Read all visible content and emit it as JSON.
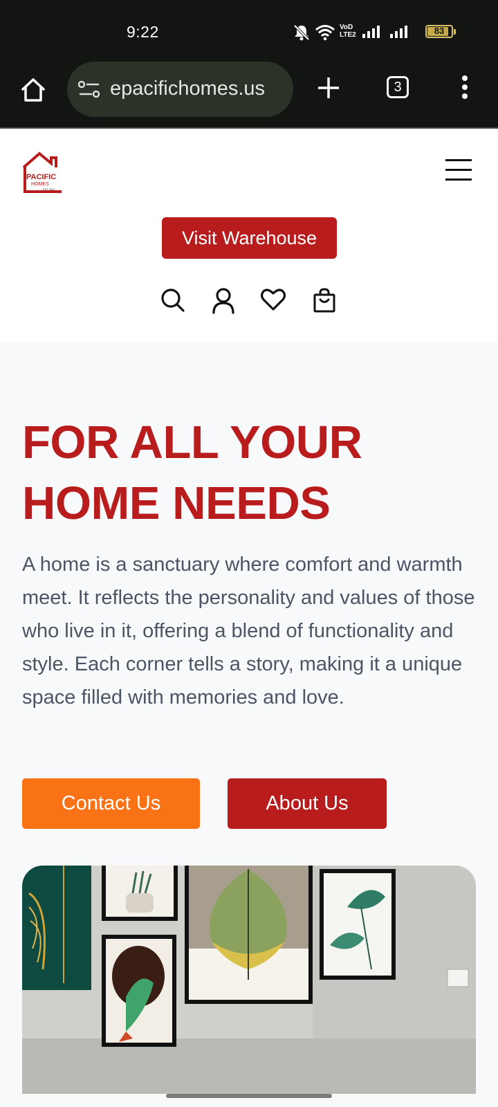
{
  "status_bar": {
    "time": "9:22",
    "network_label": "VoD LTE2",
    "battery": "83"
  },
  "browser": {
    "url": "epacifichomes.us",
    "tab_count": "3"
  },
  "header": {
    "logo_text": "PACIFIC",
    "logo_subtext": "HOMES",
    "logo_est": "EST 2021",
    "visit_label": "Visit Warehouse"
  },
  "hero": {
    "title": "FOR ALL YOUR HOME NEEDS",
    "description": "A home is a sanctuary where comfort and warmth meet. It reflects the personality and values of those who live in it, offering a blend of functionality and style. Each corner tells a story, making it a unique space filled with memories and love.",
    "contact_label": "Contact Us",
    "about_label": "About Us"
  },
  "colors": {
    "brand_red": "#b91c1c",
    "accent_orange": "#f97316",
    "text_gray": "#4b5563"
  }
}
